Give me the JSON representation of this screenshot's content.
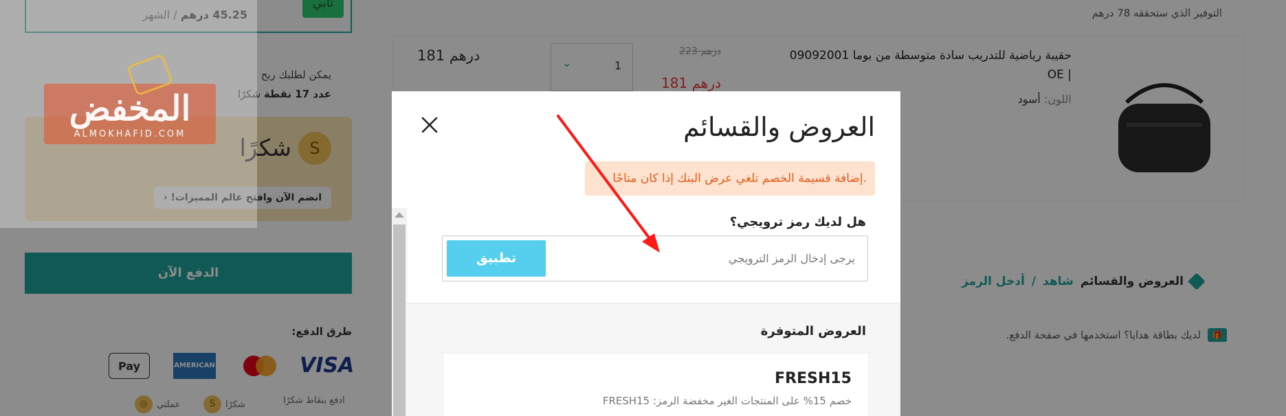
{
  "background": {
    "savings_line": "التوفير الذي ستحققه  78 درهم",
    "product": {
      "name": "حقيبة رياضية للتدريب سادة متوسطة من بوما 09092001 | OE",
      "color_label": "اللون:",
      "color_value": "أسود",
      "old_price": "223 درهم",
      "new_price": "181 درهم",
      "quantity": "1",
      "row_total": "181 درهم"
    },
    "offers_link": {
      "text": "العروض والقسائم",
      "link_see": "شاهد",
      "link_sep": "/",
      "link_enter": "أدخل الرمز"
    },
    "gift_card_line": "لديك بطاقة هدايا؟ استخدمها في صفحة الدفع.",
    "plan": {
      "price": "45.25 درهم",
      "per": "/ الشهر",
      "badge": "تابي"
    },
    "reward": {
      "line1": "يمكن لطلبك ربح",
      "line2_bold": "عدد 17 نقطة",
      "line2_rest": "شكرًا"
    },
    "shukran": {
      "coin": "S",
      "title": "شكرًا",
      "join_label": "انضم الآن وافتح عالم المميزات!"
    },
    "pay_button": "الدفع الآن",
    "payment_methods": {
      "label": "طرق الدفع:",
      "visa": "VISA",
      "amex": "AMERICAN EXPRESS",
      "apple": "Pay",
      "small_1": "ادفع بنقاط شكرًا",
      "small_2": "شكرًا",
      "small_3": "عملتي"
    }
  },
  "watermark": {
    "text": "المخفض",
    "sub": "ALMOKHAFID.COM"
  },
  "modal": {
    "title": "العروض والقسائم",
    "notice": ".إضافة قسيمة الخصم تلغي عرض البنك إذا كان متاحًا",
    "promo": {
      "label": "هل لديك رمز ترويجي؟",
      "placeholder": "يرجى إدخال الرمز الترويجي",
      "value": "",
      "apply_label": "تطبيق"
    },
    "offers": {
      "title": "العروض المتوفرة",
      "items": [
        {
          "code": "FRESH15",
          "description": "خصم 15% على المنتجات الغير مخفضة الرمز: FRESH15"
        }
      ]
    }
  },
  "colors": {
    "accent": "#1fa39a",
    "apply_button": "#56cfee",
    "notice_bg": "#fde3cf",
    "notice_text": "#e85c1a",
    "annotation_arrow": "#ff1a1a"
  }
}
